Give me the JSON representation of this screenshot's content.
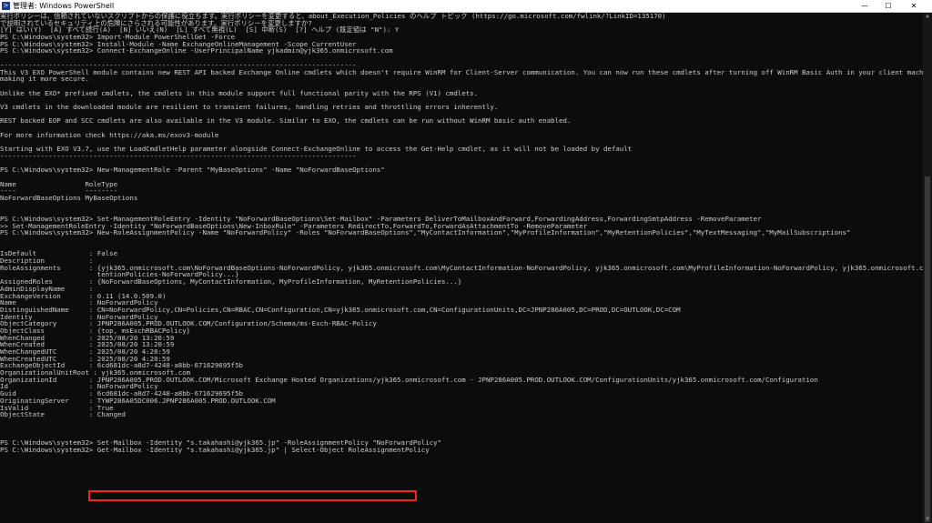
{
  "window": {
    "title": "管理者: Windows PowerShell",
    "controls": {
      "minimize": "—",
      "maximize": "☐",
      "close": "✕"
    }
  },
  "lines": [
    "実行ポリシーは、信頼されていないスクリプトからの保護に役立ちます。実行ポリシーを変更すると、about_Execution_Policies のヘルプ トピック (https://go.microsoft.com/fwlink/?LinkID=135170)",
    "で説明されているセキュリティ上の危険にさらされる可能性があります。実行ポリシーを変更しますか?",
    "[Y] はい(Y)  [A] すべて続行(A)  [N] いいえ(N)  [L] すべて無視(L)  [S] 中断(S)  [?] ヘルプ (既定値は \"N\"): Y",
    "PS C:\\Windows\\system32> Import-Module PowerShellGet -Force",
    "PS C:\\Windows\\system32> Install-Module -Name ExchangeOnlineManagement -Scope CurrentUser",
    "PS C:\\Windows\\system32> Connect-ExchangeOnline -UserPrincipalName yjkadmin@yjk365.onmicrosoft.com",
    "",
    "----------------------------------------------------------------------------------------",
    "This V3 EXO PowerShell module contains new REST API backed Exchange Online cmdlets which doesn't require WinRM for Client-Server communication. You can now run these cmdlets after turning off WinRM Basic Auth in your client machine thus",
    "making it more secure.",
    "",
    "Unlike the EXO* prefixed cmdlets, the cmdlets in this module support full functional parity with the RPS (V1) cmdlets.",
    "",
    "V3 cmdlets in the downloaded module are resilient to transient failures, handling retries and throttling errors inherently.",
    "",
    "REST backed EOP and SCC cmdlets are also available in the V3 module. Similar to EXO, the cmdlets can be run without WinRM basic auth enabled.",
    "",
    "For more information check https://aka.ms/exov3-module",
    "",
    "Starting with EXO V3.7, use the LoadCmdletHelp parameter alongside Connect-ExchangeOnline to access the Get-Help cmdlet, as it will not be loaded by default",
    "----------------------------------------------------------------------------------------",
    "",
    "PS C:\\Windows\\system32> New-ManagementRole -Parent \"MyBaseOptions\" -Name \"NoForwardBaseOptions\"",
    "",
    "Name                 RoleType",
    "----                 --------",
    "NoForwardBaseOptions MyBaseOptions",
    "",
    "",
    "PS C:\\Windows\\system32> Set-ManagementRoleEntry -Identity \"NoForwardBaseOptions\\Set-Mailbox\" -Parameters DeliverToMailboxAndForward,ForwardingAddress,ForwardingSmtpAddress -RemoveParameter",
    ">> Set-ManagementRoleEntry -Identity \"NoForwardBaseOptions\\New-InboxRule\" -Parameters RedirectTo,ForwardTo,ForwardAsAttachmentTo -RemoveParameter",
    "PS C:\\Windows\\system32> New-RoleAssignmentPolicy -Name \"NoForwardPolicy\" -Roles \"NoForwardBaseOptions\",\"MyContactInformation\",\"MyProfileInformation\",\"MyRetentionPolicies\",\"MyTextMessaging\",\"MyMailSubscriptions\"",
    "",
    "",
    "IsDefault             : False",
    "Description           :",
    "RoleAssignments       : {yjk365.onmicrosoft.com\\NoForwardBaseOptions-NoForwardPolicy, yjk365.onmicrosoft.com\\MyContactInformation-NoForwardPolicy, yjk365.onmicrosoft.com\\MyProfileInformation-NoForwardPolicy, yjk365.onmicrosoft.com\\MyRe",
    "                        tentionPolicies-NoForwardPolicy...}",
    "AssignedRoles         : {NoForwardBaseOptions, MyContactInformation, MyProfileInformation, MyRetentionPolicies...}",
    "AdminDisplayName      :",
    "ExchangeVersion       : 0.11 (14.0.509.0)",
    "Name                  : NoForwardPolicy",
    "DistinguishedName     : CN=NoForwardPolicy,CN=Policies,CN=RBAC,CN=Configuration,CN=yjk365.onmicrosoft.com,CN=ConfigurationUnits,DC=JPNP286A005,DC=PROD,DC=OUTLOOK,DC=COM",
    "Identity              : NoForwardPolicy",
    "ObjectCategory        : JPNP286A005.PROD.OUTLOOK.COM/Configuration/Schema/ms-Exch-RBAC-Policy",
    "ObjectClass           : {top, msExchRBACPolicy}",
    "WhenChanged           : 2025/08/20 13:20:59",
    "WhenCreated           : 2025/08/20 13:20:59",
    "WhenChangedUTC        : 2025/08/20 4:20:59",
    "WhenCreatedUTC        : 2025/08/20 4:20:59",
    "ExchangeObjectId      : 6cd681dc-a8d7-4248-a8bb-671629695f5b",
    "OrganizationalUnitRoot : yjk365.onmicrosoft.com",
    "OrganizationId        : JPNP286A005.PROD.OUTLOOK.COM/Microsoft Exchange Hosted Organizations/yjk365.onmicrosoft.com - JPNP286A005.PROD.OUTLOOK.COM/ConfigurationUnits/yjk365.onmicrosoft.com/Configuration",
    "Id                    : NoForwardPolicy",
    "Guid                  : 6cd681dc-a8d7-4248-a8bb-671629695f5b",
    "OriginatingServer     : TYWP286A05DC006.JPNP286A005.PROD.OUTLOOK.COM",
    "IsValid               : True",
    "ObjectState           : Changed",
    "",
    "",
    "",
    "PS C:\\Windows\\system32> Set-Mailbox -Identity \"s.takahashi@yjk365.jp\" -RoleAssignmentPolicy \"NoForwardPolicy\"",
    "PS C:\\Windows\\system32> Get-Mailbox -Identity \"s.takahashi@yjk365.jp\" | Select-Object RoleAssignmentPolicy"
  ],
  "colors": {
    "background": "#0c0c0c",
    "text": "#cccccc",
    "cmdlet": "#ffff00",
    "parameter": "#8a8a8a",
    "string": "#5a8ac8",
    "highlight_box": "#ff2020"
  }
}
